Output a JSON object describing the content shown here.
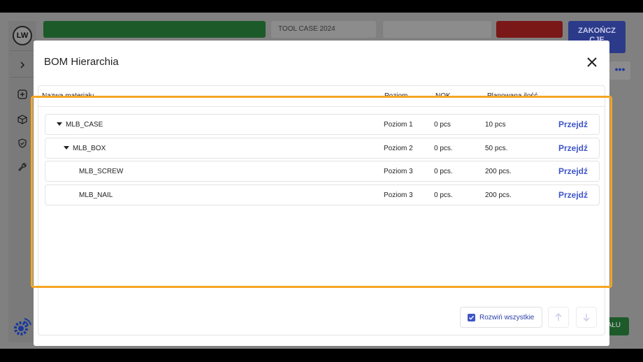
{
  "background": {
    "avatar_initials": "LW",
    "tool_text": "TOOL CASE 2024",
    "blue_button_line1": "ZAKOŃCZ",
    "blue_button_line2": "CJĘ",
    "dots": "•••",
    "bottom_green_text": "AŁU"
  },
  "modal": {
    "title": "BOM Hierarchia",
    "columns": {
      "name": "Nazwa materiału",
      "level": "Poziom",
      "nok": "NOK",
      "planned": "Planowana ilość"
    },
    "rows": [
      {
        "name": "MLB_CASE",
        "level": "Poziom 1",
        "nok": "0 pcs",
        "planned": "10 pcs",
        "action": "Przejdź",
        "expanded": true
      },
      {
        "name": "MLB_BOX",
        "level": "Poziom 2",
        "nok": "0 pcs.",
        "planned": "50 pcs.",
        "action": "Przejdź",
        "expanded": true
      },
      {
        "name": "MLB_SCREW",
        "level": "Poziom 3",
        "nok": "0 pcs.",
        "planned": "200 pcs.",
        "action": "Przejdź",
        "expanded": false
      },
      {
        "name": "MLB_NAIL",
        "level": "Poziom 3",
        "nok": "0 pcs.",
        "planned": "200 pcs.",
        "action": "Przejdź",
        "expanded": false
      }
    ],
    "expand_all_label": "Rozwiń wszystkie",
    "expand_all_checked": true
  },
  "colors": {
    "accent": "#3f55c8",
    "highlight": "#f5a623"
  }
}
